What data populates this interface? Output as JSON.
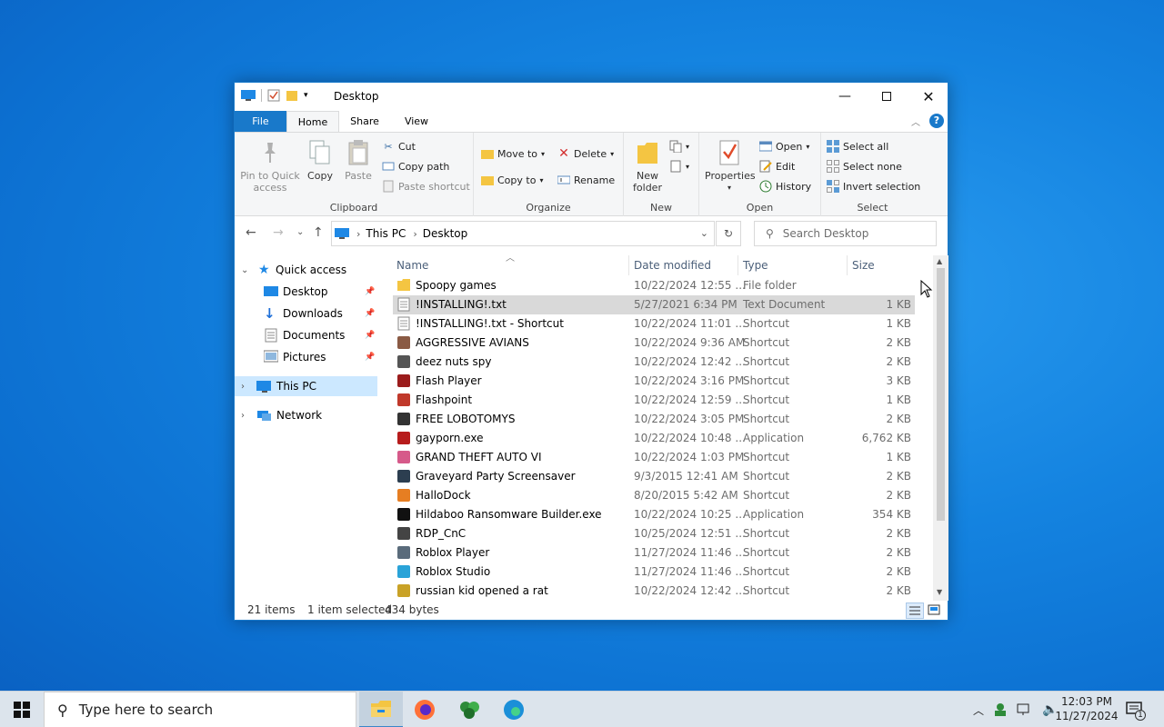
{
  "window": {
    "title": "Desktop",
    "tabs": {
      "file": "File",
      "home": "Home",
      "share": "Share",
      "view": "View"
    },
    "help": "?"
  },
  "ribbon": {
    "clipboard": {
      "label": "Clipboard",
      "pin": "Pin to Quick access",
      "pin_line1": "Pin to Quick",
      "pin_line2": "access",
      "copy": "Copy",
      "paste": "Paste",
      "cut": "Cut",
      "copy_path": "Copy path",
      "paste_shortcut": "Paste shortcut"
    },
    "organize": {
      "label": "Organize",
      "move_to": "Move to",
      "copy_to": "Copy to",
      "delete": "Delete",
      "rename": "Rename"
    },
    "new": {
      "label": "New",
      "new_folder_line1": "New",
      "new_folder_line2": "folder"
    },
    "open": {
      "label": "Open",
      "properties": "Properties",
      "open": "Open",
      "edit": "Edit",
      "history": "History"
    },
    "select": {
      "label": "Select",
      "select_all": "Select all",
      "select_none": "Select none",
      "invert": "Invert selection"
    }
  },
  "address": {
    "crumbs": [
      "This PC",
      "Desktop"
    ],
    "search_placeholder": "Search Desktop"
  },
  "navpane": {
    "quick_access": "Quick access",
    "items": [
      {
        "label": "Desktop",
        "pinned": true
      },
      {
        "label": "Downloads",
        "pinned": true
      },
      {
        "label": "Documents",
        "pinned": true
      },
      {
        "label": "Pictures",
        "pinned": true
      }
    ],
    "this_pc": "This PC",
    "network": "Network"
  },
  "columns": {
    "name": "Name",
    "date": "Date modified",
    "type": "Type",
    "size": "Size"
  },
  "files": [
    {
      "name": "Spoopy games",
      "date": "10/22/2024 12:55 ...",
      "type": "File folder",
      "size": "",
      "icon": "folder-icon",
      "color": "#f4c542"
    },
    {
      "name": "!INSTALLING!.txt",
      "date": "5/27/2021 6:34 PM",
      "type": "Text Document",
      "size": "1 KB",
      "icon": "text-file-icon",
      "color": "#ffffff",
      "selected": true
    },
    {
      "name": "!INSTALLING!.txt - Shortcut",
      "date": "10/22/2024 11:01 ...",
      "type": "Shortcut",
      "size": "1 KB",
      "icon": "text-shortcut-icon",
      "color": "#ffffff"
    },
    {
      "name": "AGGRESSIVE AVIANS",
      "date": "10/22/2024 9:36 AM",
      "type": "Shortcut",
      "size": "2 KB",
      "icon": "game-shortcut-icon",
      "color": "#8a5a44"
    },
    {
      "name": "deez nuts spy",
      "date": "10/22/2024 12:42 ...",
      "type": "Shortcut",
      "size": "2 KB",
      "icon": "shortcut-icon",
      "color": "#555555"
    },
    {
      "name": "Flash Player",
      "date": "10/22/2024 3:16 PM",
      "type": "Shortcut",
      "size": "3 KB",
      "icon": "flash-icon",
      "color": "#9b1c1c"
    },
    {
      "name": "Flashpoint",
      "date": "10/22/2024 12:59 ...",
      "type": "Shortcut",
      "size": "1 KB",
      "icon": "flashpoint-icon",
      "color": "#c0392b"
    },
    {
      "name": "FREE LOBOTOMYS",
      "date": "10/22/2024 3:05 PM",
      "type": "Shortcut",
      "size": "2 KB",
      "icon": "skull-icon",
      "color": "#333333"
    },
    {
      "name": "gayporn.exe",
      "date": "10/22/2024 10:48 ...",
      "type": "Application",
      "size": "6,762 KB",
      "icon": "flash-app-icon",
      "color": "#b71c1c"
    },
    {
      "name": "GRAND THEFT AUTO VI",
      "date": "10/22/2024 1:03 PM",
      "type": "Shortcut",
      "size": "1 KB",
      "icon": "gta-icon",
      "color": "#d65a8a"
    },
    {
      "name": "Graveyard Party Screensaver",
      "date": "9/3/2015 12:41 AM",
      "type": "Shortcut",
      "size": "2 KB",
      "icon": "screensaver-icon",
      "color": "#2c3e50"
    },
    {
      "name": "HalloDock",
      "date": "8/20/2015 5:42 AM",
      "type": "Shortcut",
      "size": "2 KB",
      "icon": "hallodock-icon",
      "color": "#e67e22"
    },
    {
      "name": "Hildaboo Ransomware Builder.exe",
      "date": "10/22/2024 10:25 ...",
      "type": "Application",
      "size": "354 KB",
      "icon": "ransomware-icon",
      "color": "#111111"
    },
    {
      "name": "RDP_CnC",
      "date": "10/25/2024 12:51 ...",
      "type": "Shortcut",
      "size": "2 KB",
      "icon": "rdp-icon",
      "color": "#444444"
    },
    {
      "name": "Roblox Player",
      "date": "11/27/2024 11:46 ...",
      "type": "Shortcut",
      "size": "2 KB",
      "icon": "roblox-icon",
      "color": "#5a6b7b"
    },
    {
      "name": "Roblox Studio",
      "date": "11/27/2024 11:46 ...",
      "type": "Shortcut",
      "size": "2 KB",
      "icon": "roblox-studio-icon",
      "color": "#2aa3d8"
    },
    {
      "name": "russian kid opened a rat",
      "date": "10/22/2024 12:42 ...",
      "type": "Shortcut",
      "size": "2 KB",
      "icon": "rat-icon",
      "color": "#c9a227"
    }
  ],
  "status": {
    "count": "21 items",
    "selection": "1 item selected",
    "bytes": "434 bytes"
  },
  "taskbar": {
    "search_placeholder": "Type here to search",
    "time": "12:03 PM",
    "date": "11/27/2024",
    "notification_count": "1"
  }
}
